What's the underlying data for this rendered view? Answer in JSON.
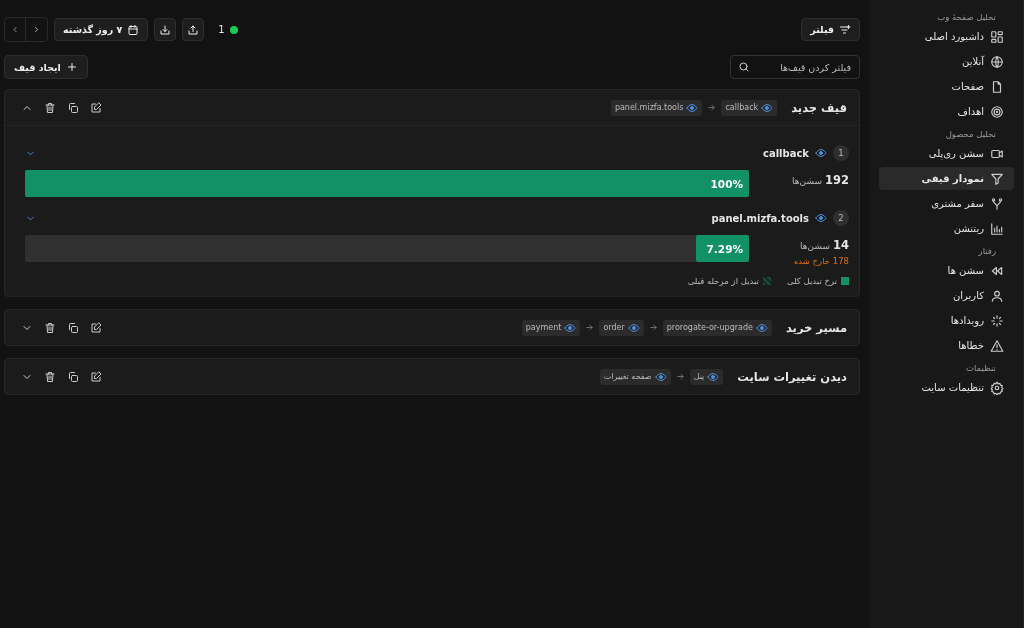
{
  "sidebar": {
    "sections": [
      {
        "title": "تحلیل صفحهٔ وب",
        "items": [
          {
            "label": "داشبورد اصلی",
            "selected": false
          },
          {
            "label": "آنلاین",
            "selected": false
          },
          {
            "label": "صفحات",
            "selected": false
          },
          {
            "label": "اهداف",
            "selected": false
          }
        ]
      },
      {
        "title": "تحلیل محصول",
        "items": [
          {
            "label": "سشن ری‌پلی",
            "selected": false
          },
          {
            "label": "نمودار قیفی",
            "selected": true
          },
          {
            "label": "سفر مشتری",
            "selected": false
          },
          {
            "label": "ریتنشن",
            "selected": false
          }
        ]
      },
      {
        "title": "رفتار",
        "items": [
          {
            "label": "سشن ها",
            "selected": false
          },
          {
            "label": "کاربران",
            "selected": false
          },
          {
            "label": "رویدادها",
            "selected": false
          },
          {
            "label": "خطاها",
            "selected": false
          }
        ]
      },
      {
        "title": "تنظیمات",
        "items": [
          {
            "label": "تنظیمات سایت",
            "selected": false
          }
        ]
      }
    ]
  },
  "toolbar": {
    "filter_button": "فیلتر",
    "live_count": "1",
    "date_range": "۷ روز گذشته"
  },
  "search": {
    "placeholder": "فیلتر کردن قیف‌ها"
  },
  "create_button": "ایجاد قیف",
  "funnels": [
    {
      "title": "قیف جدید",
      "expanded": true,
      "chips": [
        "callback",
        "panel.mizfa.tools"
      ],
      "steps": [
        {
          "number": "1",
          "name": "callback",
          "sessions": "192",
          "sessions_label": "سشن‌ها",
          "percent": "100%",
          "level": 1
        },
        {
          "number": "2",
          "name": "panel.mizfa.tools",
          "sessions": "14",
          "sessions_label": "سشن‌ها",
          "dropped": "178 خارج شده",
          "percent": "7.29%",
          "level": 0.0729
        }
      ],
      "legend": [
        "نرخ تبدیل کلی",
        "تبدیل از مرحله قبلی"
      ]
    },
    {
      "title": "مسیر خرید",
      "expanded": false,
      "chips": [
        "prorogate-or-upgrade",
        "order",
        "payment"
      ]
    },
    {
      "title": "دیدن تغییرات سایت",
      "expanded": false,
      "chips": [
        "پنل",
        "صفحه تغییرات"
      ]
    }
  ]
}
